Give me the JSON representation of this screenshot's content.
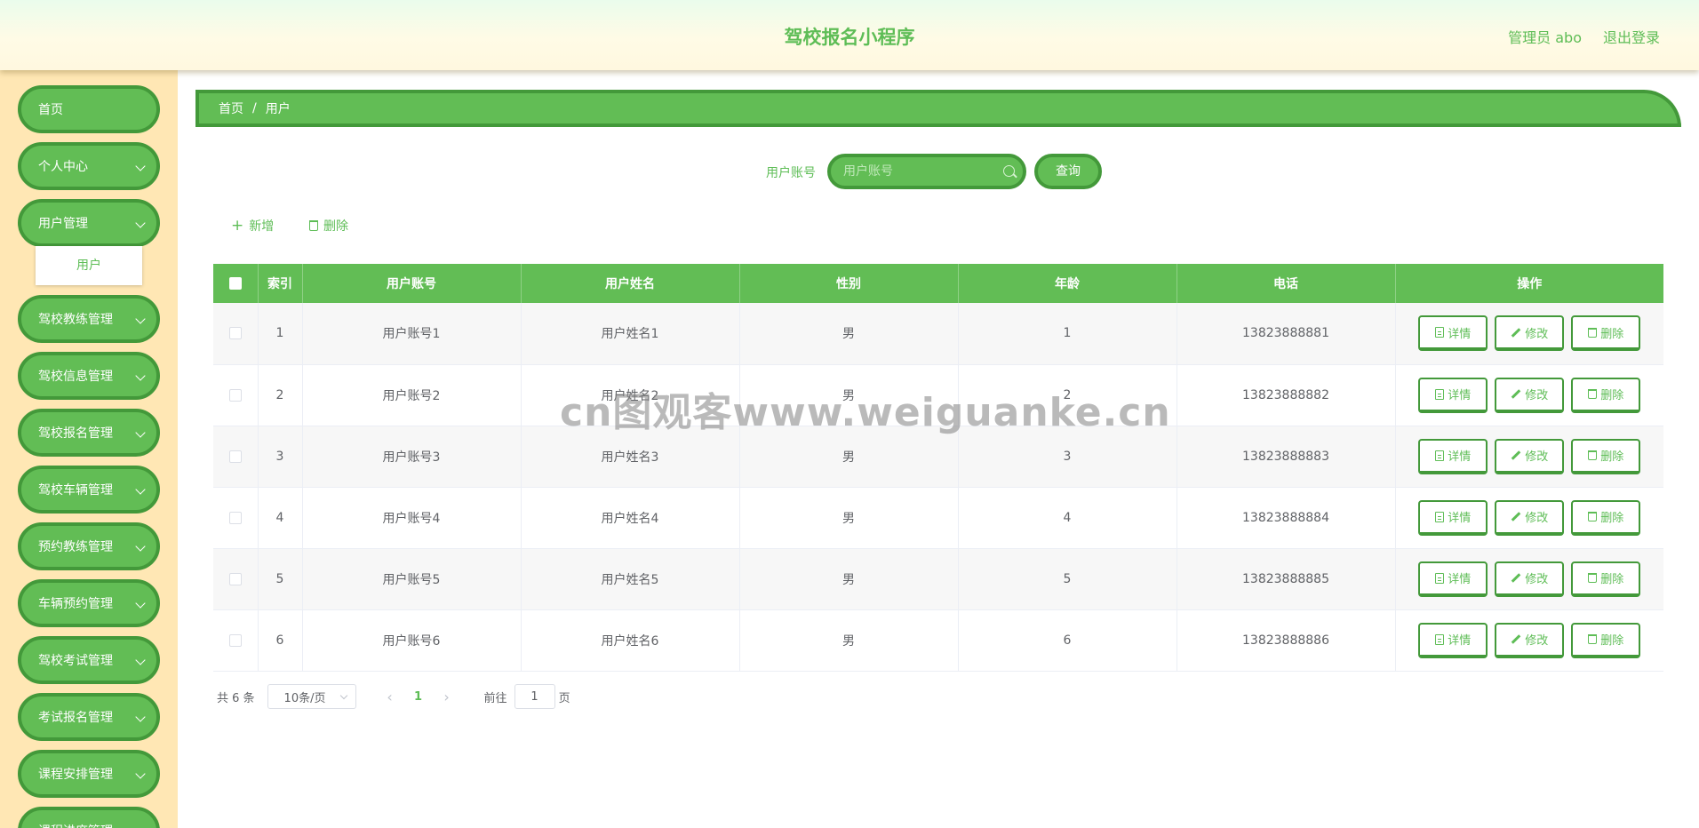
{
  "header": {
    "title": "驾校报名小程序",
    "user": "管理员 abo",
    "logout": "退出登录"
  },
  "sidebar": {
    "items": [
      {
        "label": "首页",
        "has_arrow": false
      },
      {
        "label": "个人中心",
        "has_arrow": true
      },
      {
        "label": "用户管理",
        "has_arrow": true
      },
      {
        "label": "驾校教练管理",
        "has_arrow": true
      },
      {
        "label": "驾校信息管理",
        "has_arrow": true
      },
      {
        "label": "驾校报名管理",
        "has_arrow": true
      },
      {
        "label": "驾校车辆管理",
        "has_arrow": true
      },
      {
        "label": "预约教练管理",
        "has_arrow": true
      },
      {
        "label": "车辆预约管理",
        "has_arrow": true
      },
      {
        "label": "驾校考试管理",
        "has_arrow": true
      },
      {
        "label": "考试报名管理",
        "has_arrow": true
      },
      {
        "label": "课程安排管理",
        "has_arrow": true
      },
      {
        "label": "课程进度管理",
        "has_arrow": true
      }
    ],
    "submenu_label": "用户"
  },
  "breadcrumb": {
    "home": "首页",
    "separator": "/",
    "current": "用户"
  },
  "search": {
    "label": "用户账号",
    "placeholder": "用户账号",
    "button": "查询"
  },
  "toolbar": {
    "add": "新增",
    "delete": "删除"
  },
  "table": {
    "columns": [
      "索引",
      "用户账号",
      "用户姓名",
      "性别",
      "年龄",
      "电话",
      "操作"
    ],
    "rows": [
      {
        "index": "1",
        "account": "用户账号1",
        "name": "用户姓名1",
        "gender": "男",
        "age": "1",
        "phone": "13823888881"
      },
      {
        "index": "2",
        "account": "用户账号2",
        "name": "用户姓名2",
        "gender": "男",
        "age": "2",
        "phone": "13823888882"
      },
      {
        "index": "3",
        "account": "用户账号3",
        "name": "用户姓名3",
        "gender": "男",
        "age": "3",
        "phone": "13823888883"
      },
      {
        "index": "4",
        "account": "用户账号4",
        "name": "用户姓名4",
        "gender": "男",
        "age": "4",
        "phone": "13823888884"
      },
      {
        "index": "5",
        "account": "用户账号5",
        "name": "用户姓名5",
        "gender": "男",
        "age": "5",
        "phone": "13823888885"
      },
      {
        "index": "6",
        "account": "用户账号6",
        "name": "用户姓名6",
        "gender": "男",
        "age": "6",
        "phone": "13823888886"
      }
    ],
    "actions": {
      "detail": "详情",
      "edit": "修改",
      "delete": "删除"
    }
  },
  "watermark": "cn图观客www.weiguanke.cn",
  "pagination": {
    "total": "共 6 条",
    "page_size": "10条/页",
    "current_page": "1",
    "goto_label": "前往",
    "goto_value": "1",
    "page_suffix": "页"
  },
  "colors": {
    "accent": "#62bd55",
    "accent_dark": "#43993a",
    "sidebar_bg": "#ffe7b4"
  }
}
